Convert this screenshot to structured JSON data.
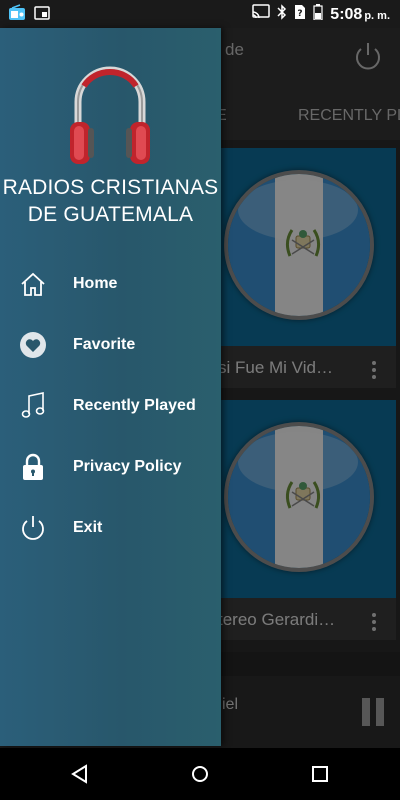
{
  "status_bar": {
    "time": "5:08",
    "ampm": "p. m.",
    "icons": [
      "radio-app-icon",
      "screenshot-icon",
      "cast-icon",
      "bluetooth-icon",
      "no-sim-icon",
      "battery-icon"
    ]
  },
  "background_app": {
    "header_title_fragment": "de",
    "tab_partial": "E",
    "tab_recent": "RECENTLY PL",
    "cards": [
      {
        "title": "si Fue Mi Vid…"
      },
      {
        "title": "tereo Gerardi…"
      }
    ],
    "player_title_fragment": "iel"
  },
  "drawer": {
    "app_title": "RADIOS CRISTIANAS DE GUATEMALA",
    "menu": [
      {
        "label": "Home",
        "icon": "home-icon"
      },
      {
        "label": "Favorite",
        "icon": "heart-icon"
      },
      {
        "label": "Recently Played",
        "icon": "music-note-icon"
      },
      {
        "label": "Privacy Policy",
        "icon": "lock-icon"
      },
      {
        "label": "Exit",
        "icon": "power-icon"
      }
    ]
  },
  "nav_bar": {
    "buttons": [
      "back-icon",
      "home-circle-icon",
      "recents-square-icon"
    ]
  },
  "colors": {
    "drawer": "#28576b",
    "flag_blue": "#3b8fd0",
    "headphones_red": "#c0242c"
  }
}
